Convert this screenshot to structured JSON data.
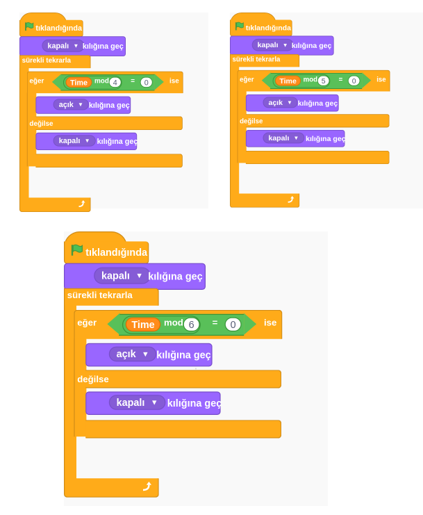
{
  "panels": [
    {
      "id": "top-left",
      "event": "tıklandığında",
      "first_block": {
        "costume": "kapalı",
        "action": "kılığına geç"
      },
      "forever": "sürekli tekrarla",
      "if_label": "eğer",
      "else_label": "değilse",
      "then_label": "ise",
      "reporter": "Time",
      "operator": "mod",
      "modulus": "4",
      "equals": "=",
      "compare": "0",
      "if_block": {
        "costume": "açık",
        "action": "kılığına geç"
      },
      "else_block": {
        "costume": "kapalı",
        "action": "kılığına geç"
      }
    },
    {
      "id": "top-right",
      "event": "tıklandığında",
      "first_block": {
        "costume": "kapalı",
        "action": "kılığına geç"
      },
      "forever": "sürekli tekrarla",
      "if_label": "eğer",
      "else_label": "değilse",
      "then_label": "ise",
      "reporter": "Time",
      "operator": "mod",
      "modulus": "5",
      "equals": "=",
      "compare": "0",
      "if_block": {
        "costume": "açık",
        "action": "kılığına geç"
      },
      "else_block": {
        "costume": "kapalı",
        "action": "kılığına geç"
      }
    },
    {
      "id": "bottom",
      "event": "tıklandığında",
      "first_block": {
        "costume": "kapalı",
        "action": "kılığına geç"
      },
      "forever": "sürekli tekrarla",
      "if_label": "eğer",
      "else_label": "değilse",
      "then_label": "ise",
      "reporter": "Time",
      "operator": "mod",
      "modulus": "6",
      "equals": "=",
      "compare": "0",
      "if_block": {
        "costume": "açık",
        "action": "kılığına geç"
      },
      "else_block": {
        "costume": "kapalı",
        "action": "kılığına geç"
      }
    }
  ],
  "icons": {
    "flag": "green-flag-icon",
    "loop": "loop-arrow-icon",
    "dropdown": "dropdown-caret-icon"
  },
  "colors": {
    "events": "#ffab19",
    "looks": "#9966ff",
    "control": "#ffab19",
    "operators": "#59c059",
    "reporter": "#ff8c1a"
  }
}
